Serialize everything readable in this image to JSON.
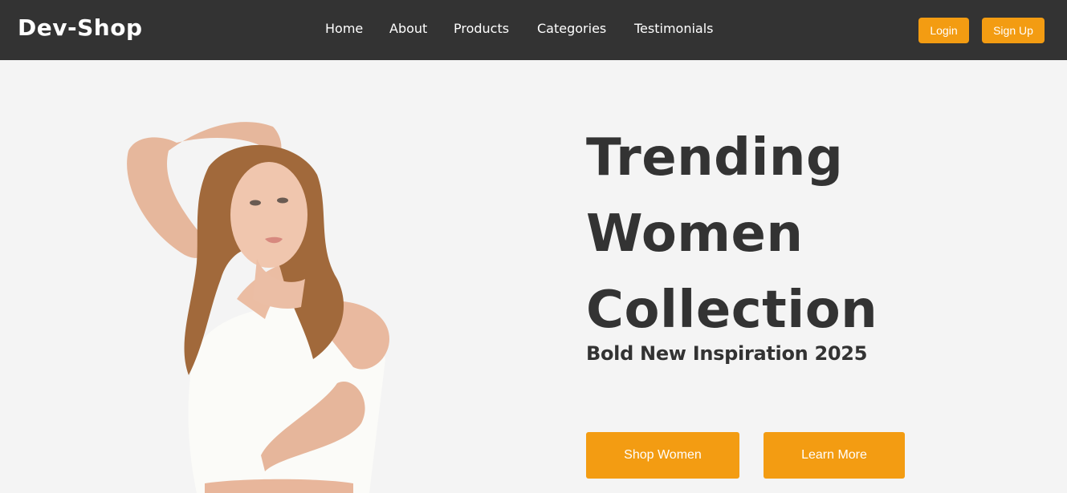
{
  "brand": {
    "logo": "Dev-Shop",
    "accent_color": "#f39c12",
    "nav_bg": "#333333"
  },
  "nav": {
    "links": [
      "Home",
      "About",
      "Products",
      "Categories",
      "Testimonials"
    ],
    "login_label": "Login",
    "signup_label": "Sign Up"
  },
  "hero": {
    "title_line1": "Trending",
    "title_line2": "Women",
    "title_line3": "Collection",
    "subtitle": "Bold New Inspiration 2025",
    "primary_cta": "Shop Women",
    "secondary_cta": "Learn More"
  }
}
